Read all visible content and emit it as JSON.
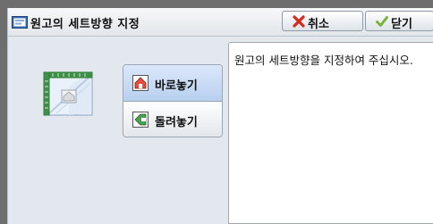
{
  "header": {
    "title": "원고의 세트방향 지정",
    "cancel_label": "취소",
    "close_label": "닫기"
  },
  "options": [
    {
      "label": "바로놓기",
      "selected": true
    },
    {
      "label": "돌려놓기",
      "selected": false
    }
  ],
  "message": "원고의 세트방향을 지정하여 주십시오.",
  "colors": {
    "cancel_icon": "#d42a1f",
    "close_icon": "#7ab43a",
    "selected_option": "#c6d9f4",
    "preview_frame": "#2f7d3a"
  }
}
